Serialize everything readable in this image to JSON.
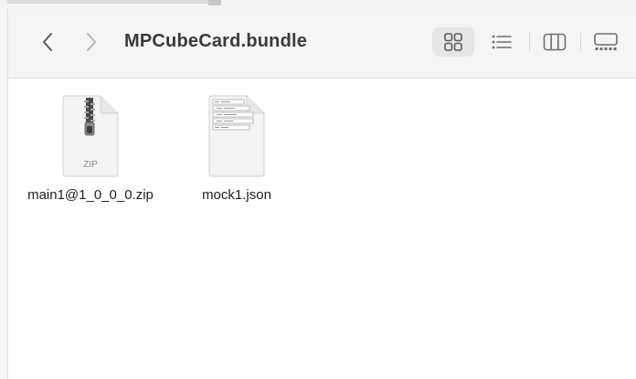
{
  "window": {
    "title": "MPCubeCard.bundle"
  },
  "toolbar": {
    "back_icon": "chevron-left-icon",
    "forward_icon": "chevron-right-icon",
    "view_modes": [
      {
        "name": "icon-view",
        "icon": "grid-icon",
        "selected": true
      },
      {
        "name": "list-view",
        "icon": "list-icon",
        "selected": false
      },
      {
        "name": "column-view",
        "icon": "columns-icon",
        "selected": false
      },
      {
        "name": "gallery-view",
        "icon": "gallery-icon",
        "selected": false
      }
    ]
  },
  "files": [
    {
      "name": "main1@1_0_0_0.zip",
      "type_label": "ZIP",
      "icon": "zip-file-icon"
    },
    {
      "name": "mock1.json",
      "type_label": "",
      "icon": "json-file-icon"
    }
  ],
  "colors": {
    "toolbar_bg": "#f5f5f5",
    "title": "#3a3a3a",
    "icon_gray": "#6e6e6e",
    "selected_view_bg": "#e6e6e6"
  }
}
